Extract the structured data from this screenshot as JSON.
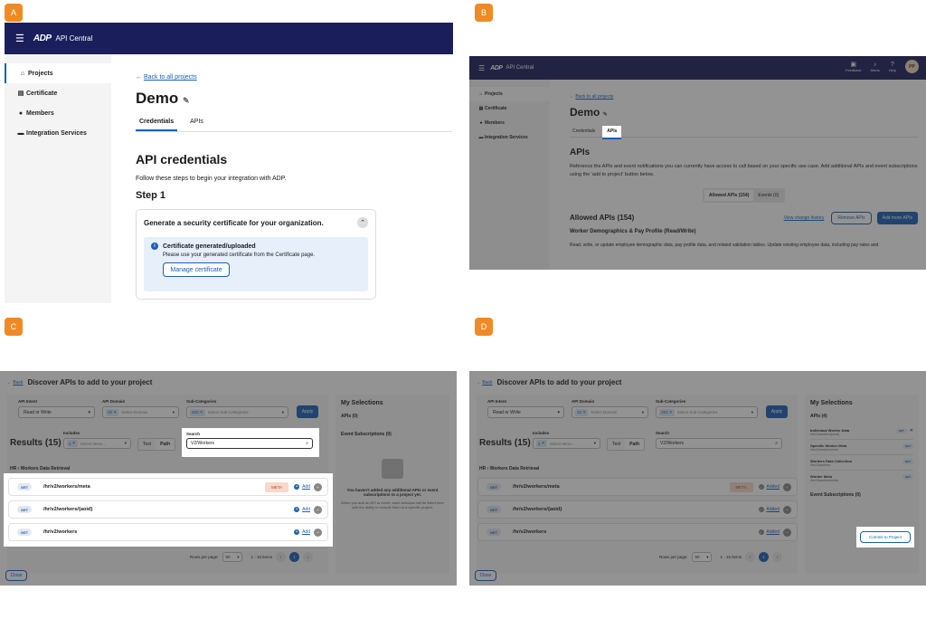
{
  "labels": [
    "A",
    "B",
    "C",
    "D"
  ],
  "app": {
    "title": "API Central",
    "logo": "ADP"
  },
  "sidebar": {
    "items": [
      {
        "label": "Projects",
        "icon": "home-icon"
      },
      {
        "label": "Certificate",
        "icon": "certificate-icon"
      },
      {
        "label": "Members",
        "icon": "person-icon"
      },
      {
        "label": "Integration Services",
        "icon": "briefcase-icon"
      }
    ]
  },
  "panel_a": {
    "back": "Back to all projects",
    "title": "Demo",
    "tabs": [
      "Credentials",
      "APIs"
    ],
    "section_title": "API credentials",
    "intro": "Follow these steps to begin your integration with ADP.",
    "step": "Step 1",
    "card_title": "Generate a security certificate for your organization.",
    "info_title": "Certificate generated/uploaded",
    "info_text": "Please use your generated certificate from the Certificate page.",
    "manage_btn": "Manage certificate"
  },
  "panel_b": {
    "header_icons": [
      {
        "label": "Feedback"
      },
      {
        "label": "Alerts"
      },
      {
        "label": "Help"
      }
    ],
    "avatar": "PP",
    "back": "Back to all projects",
    "title": "Demo",
    "tabs": [
      "Credentials",
      "APIs"
    ],
    "section_title": "APIs",
    "desc": "Reference the APIs and event notifications you can currently have access to call based on your specific use case. Add additional APIs and event subscriptions using the 'add to project' button below.",
    "toggle": [
      "Allowed APIs (154)",
      "Events (0)"
    ],
    "allowed_title": "Allowed APIs (154)",
    "history": "View change history",
    "remove_btn": "Remove APIs",
    "add_btn": "Add more APIs",
    "group_title": "Worker Demographics & Pay Profile (Read/Write)",
    "group_desc": "Read, write, or update employee demographic data, pay profile data, and related validation tables. Update existing employee data, including pay rates and"
  },
  "discover": {
    "back": "Back",
    "title": "Discover APIs to add to your project",
    "intent_label": "API Intent",
    "intent_value": "Read or Write",
    "domain_label": "API Domain",
    "domain_chip": "10",
    "domain_placeholder": "Select Domain",
    "sub_label": "Sub-Categories",
    "sub_chip": "253",
    "sub_placeholder": "Select Sub-Categories",
    "apply": "Apply",
    "results": "Results (15)",
    "includes_label": "Includes",
    "includes_chip": "2",
    "includes_placeholder": "Select Items...",
    "text_btn": "Text",
    "path_btn": "Path",
    "search_label": "Search",
    "search_value": "V2/Workers",
    "breadcrumb": "HR › Workers Data Retrieval",
    "rows": [
      {
        "method": "GET",
        "path": "/hr/v2/workers/meta",
        "meta": "META"
      },
      {
        "method": "GET",
        "path": "/hr/v2/workers/{aoid}",
        "meta": ""
      },
      {
        "method": "GET",
        "path": "/hr/v2/workers",
        "meta": ""
      }
    ],
    "add": "Add",
    "added": "Added",
    "rows_per_page": "Rows per page:",
    "rpp_value": "50",
    "range": "1 - 15 items",
    "page": "1",
    "close": "Close",
    "sel_title": "My Selections",
    "apis_zero": "APIs (0)",
    "events": "Event Subscriptions (0)",
    "empty1": "You haven't added any additional APIs or event subscriptions to a project yet.",
    "empty2": "When you add an API or event, each selection will be listed here with the ability to commit them to a specific project.",
    "apis_four": "APIs (4)",
    "selections": [
      {
        "name": "Individual Worker Data",
        "path": "/hr/v2/workers/{aoid}"
      },
      {
        "name": "Specific Worker Meta",
        "path": "/hr/v2/workers/meta"
      },
      {
        "name": "Workers Data Collection",
        "path": "/hr/v2/workers"
      },
      {
        "name": "Worker Meta",
        "path": "/hr/v2/workers/meta"
      }
    ],
    "commit": "Commit to Project"
  }
}
